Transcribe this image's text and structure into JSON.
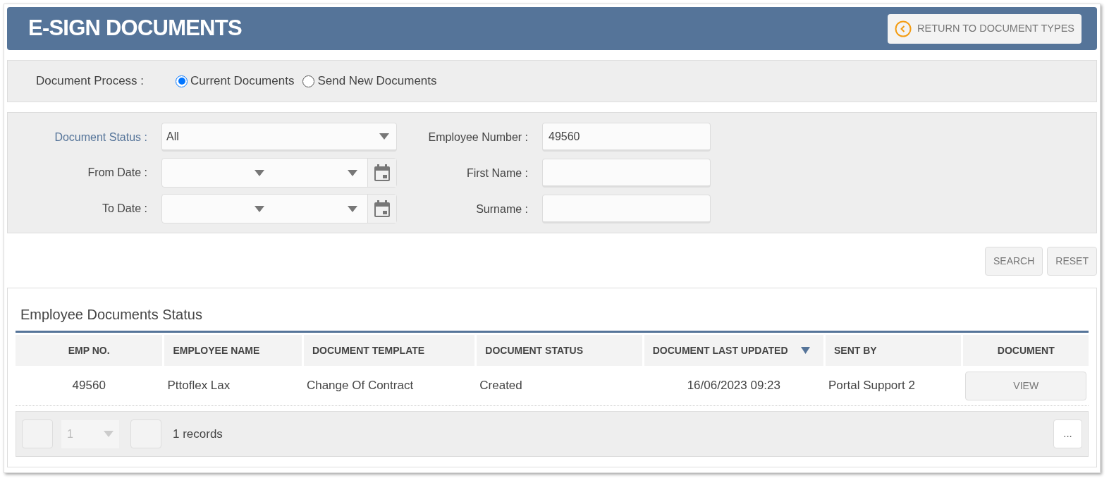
{
  "header": {
    "title": "E-SIGN DOCUMENTS",
    "return_button": "RETURN TO DOCUMENT TYPES"
  },
  "process": {
    "label": "Document Process :",
    "options": [
      {
        "label": "Current Documents",
        "selected": true
      },
      {
        "label": "Send New Documents",
        "selected": false
      }
    ]
  },
  "filters": {
    "document_status": {
      "label": "Document Status :",
      "value": "All"
    },
    "from_date": {
      "label": "From Date :"
    },
    "to_date": {
      "label": "To Date :"
    },
    "employee_number": {
      "label": "Employee Number :",
      "value": "49560"
    },
    "first_name": {
      "label": "First Name :"
    },
    "surname": {
      "label": "Surname :"
    }
  },
  "actions": [
    "SEARCH",
    "RESET"
  ],
  "table": {
    "title": "Employee Documents Status",
    "columns": [
      {
        "label": "EMP NO.",
        "sorted": false
      },
      {
        "label": "EMPLOYEE NAME",
        "sorted": false
      },
      {
        "label": "DOCUMENT TEMPLATE",
        "sorted": false
      },
      {
        "label": "DOCUMENT STATUS",
        "sorted": false
      },
      {
        "label": "DOCUMENT LAST UPDATED",
        "sorted": true
      },
      {
        "label": "SENT BY",
        "sorted": false
      },
      {
        "label": "DOCUMENT",
        "sorted": false
      }
    ],
    "rows": [
      {
        "cells": [
          "49560",
          "Pttoflex Lax",
          "Change Of Contract",
          "Created",
          "16/06/2023 09:23",
          "Portal Support 2"
        ],
        "action": "VIEW"
      }
    ]
  },
  "pager": {
    "page": "1",
    "records": "1 records",
    "more": "..."
  }
}
